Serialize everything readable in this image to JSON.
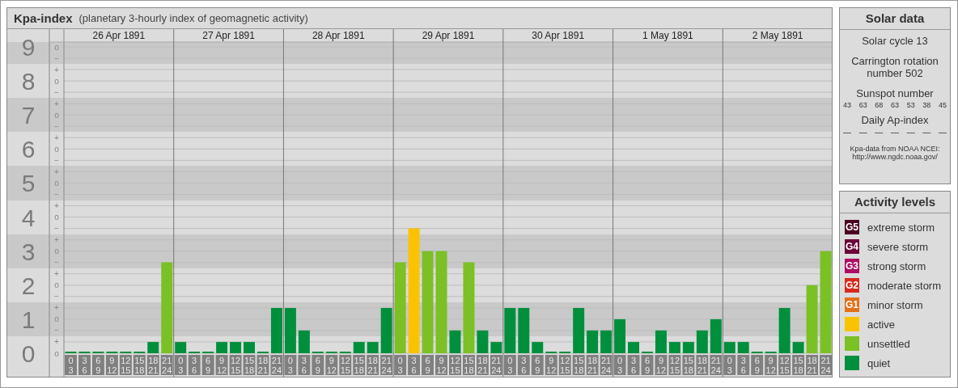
{
  "kp_panel": {
    "title": "Kpa-index",
    "subtitle": "(planetary 3-hourly index of geomagnetic activity)",
    "days": [
      "26 Apr 1891",
      "27 Apr 1891",
      "28 Apr 1891",
      "29 Apr 1891",
      "30 Apr 1891",
      "1 May 1891",
      "2 May 1891"
    ],
    "y_marks": [
      "o",
      "−",
      "+",
      "o",
      "−",
      "+",
      "o",
      "−",
      "+",
      "o",
      "−",
      "+",
      "o",
      "−",
      "+",
      "o",
      "−",
      "+",
      "o",
      "−",
      "+",
      "o",
      "−",
      "+",
      "o",
      "−",
      "+",
      "o"
    ],
    "chart_data": {
      "type": "bar",
      "grid": true,
      "ylim": [
        0,
        9
      ],
      "yticks": [
        {
          "value": 0,
          "label": "0"
        },
        {
          "value": 1,
          "label": "1"
        },
        {
          "value": 2,
          "label": "2"
        },
        {
          "value": 3,
          "label": "3"
        },
        {
          "value": 4,
          "label": "4"
        },
        {
          "value": 5,
          "label": "5"
        },
        {
          "value": 6,
          "label": "6"
        },
        {
          "value": 7,
          "label": "7"
        },
        {
          "value": 8,
          "label": "8"
        },
        {
          "value": 9,
          "label": "9"
        }
      ],
      "categories": [
        "0 3",
        "3 6",
        "6 9",
        "9 12",
        "12 15",
        "15 18",
        "18 21",
        "21 24",
        "0 3",
        "3 6",
        "6 9",
        "9 12",
        "12 15",
        "15 18",
        "18 21",
        "21 24",
        "0 3",
        "3 6",
        "6 9",
        "9 12",
        "12 15",
        "15 18",
        "18 21",
        "21 24",
        "0 3",
        "3 6",
        "6 9",
        "9 12",
        "12 15",
        "15 18",
        "18 21",
        "21 24",
        "0 3",
        "3 6",
        "6 9",
        "9 12",
        "12 15",
        "15 18",
        "18 21",
        "21 24",
        "0 3",
        "3 6",
        "6 9",
        "9 12",
        "12 15",
        "15 18",
        "18 21",
        "21 24",
        "0 3",
        "3 6",
        "6 9",
        "9 12",
        "12 15",
        "15 18",
        "18 21",
        "21 24"
      ],
      "series": [
        {
          "color": "#008f3c",
          "values": [
            0,
            0,
            0,
            0,
            0,
            0,
            0.33,
            null,
            0.33,
            0,
            0,
            0.33,
            0.33,
            0.33,
            0,
            1.33,
            1.33,
            0.67,
            0,
            0,
            0,
            0.33,
            0.33,
            1.33,
            null,
            null,
            null,
            null,
            0.67,
            null,
            0.67,
            0.33,
            1.33,
            1.33,
            0.33,
            0,
            0,
            1.33,
            0.67,
            0.67,
            1,
            0.33,
            0,
            0.67,
            0.33,
            0.33,
            0.67,
            1,
            0.33,
            0.33,
            0,
            0,
            1.33,
            0.33,
            null,
            null
          ]
        },
        {
          "color": "#7bc024",
          "values": [
            null,
            null,
            null,
            null,
            null,
            null,
            null,
            2.67,
            null,
            null,
            null,
            null,
            null,
            null,
            null,
            null,
            null,
            null,
            null,
            null,
            null,
            null,
            null,
            null,
            2.67,
            null,
            3,
            3,
            null,
            2.67,
            null,
            null,
            null,
            null,
            null,
            null,
            null,
            null,
            null,
            null,
            null,
            null,
            null,
            null,
            null,
            null,
            null,
            null,
            null,
            null,
            null,
            null,
            null,
            null,
            2,
            3
          ]
        },
        {
          "color": "#fac300",
          "values": [
            null,
            null,
            null,
            null,
            null,
            null,
            null,
            null,
            null,
            null,
            null,
            null,
            null,
            null,
            null,
            null,
            null,
            null,
            null,
            null,
            null,
            null,
            null,
            null,
            null,
            3.67,
            null,
            null,
            null,
            null,
            null,
            null,
            null,
            null,
            null,
            null,
            null,
            null,
            null,
            null,
            null,
            null,
            null,
            null,
            null,
            null,
            null,
            null,
            null,
            null,
            null,
            null,
            null,
            null,
            null,
            null
          ]
        }
      ]
    }
  },
  "solar_panel": {
    "title": "Solar data",
    "solar_cycle": "Solar cycle 13",
    "carrington": "Carrington rotation number 502",
    "sunspot_label": "Sunspot number",
    "sunspot_numbers": [
      "43",
      "63",
      "68",
      "63",
      "53",
      "38",
      "45"
    ],
    "ap_label": "Daily Ap-index",
    "ap_values": [
      "—",
      "—",
      "—",
      "—",
      "—",
      "—",
      "—"
    ],
    "source": "Kpa-data from NOAA NCEI: http://www.ngdc.noaa.gov/"
  },
  "legend": {
    "title": "Activity levels",
    "items": [
      {
        "badge": "G5",
        "label": "extreme storm",
        "color": "#4a0020"
      },
      {
        "badge": "G4",
        "label": "severe storm",
        "color": "#6c0039"
      },
      {
        "badge": "G3",
        "label": "strong storm",
        "color": "#ad0c62"
      },
      {
        "badge": "G2",
        "label": "moderate storm",
        "color": "#d52b1e"
      },
      {
        "badge": "G1",
        "label": "minor storm",
        "color": "#e5701a"
      },
      {
        "label": "active",
        "color": "#fac300"
      },
      {
        "label": "unsettled",
        "color": "#7bc024"
      },
      {
        "label": "quiet",
        "color": "#008f3c"
      }
    ]
  }
}
